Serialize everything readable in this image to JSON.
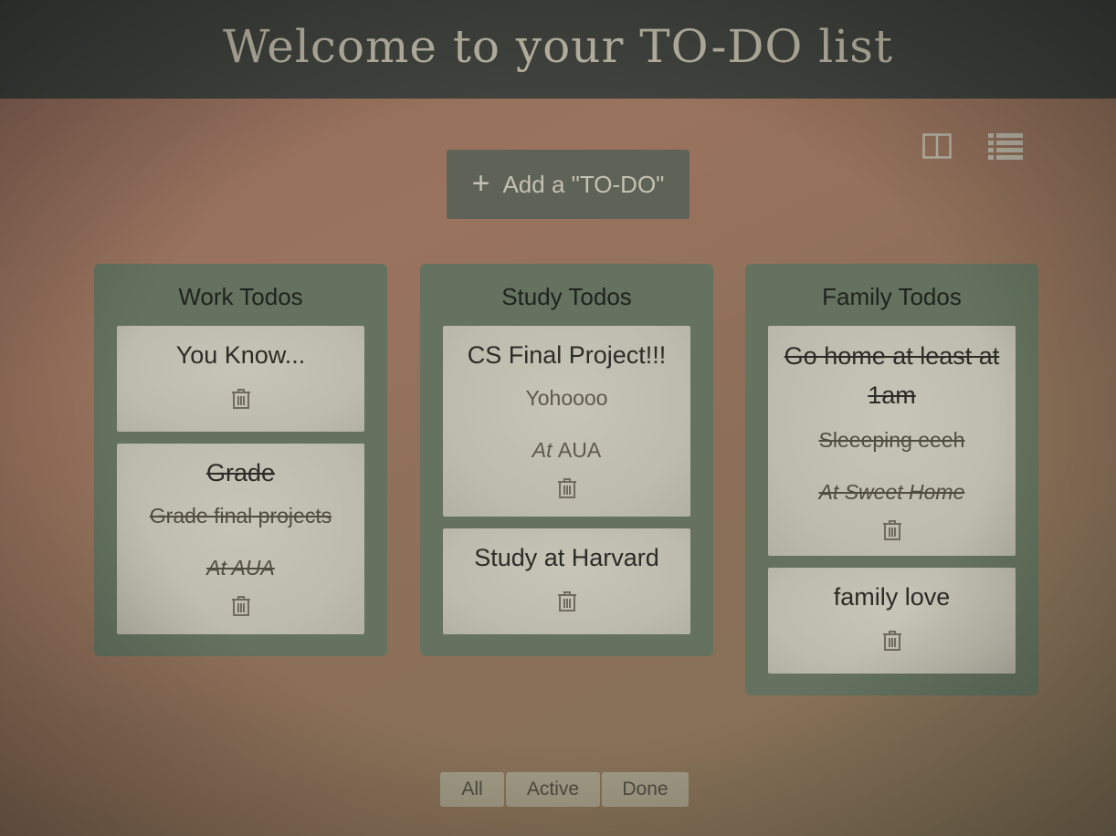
{
  "header": {
    "title": "Welcome to your TO-DO list"
  },
  "view_toggles": {
    "columns_icon": "columns-icon",
    "list_icon": "list-icon"
  },
  "add_button": {
    "icon": "plus-icon",
    "label": "Add a \"TO-DO\""
  },
  "columns": [
    {
      "title": "Work Todos",
      "cards": [
        {
          "title": "You Know...",
          "done": false
        },
        {
          "title": "Grade",
          "description": "Grade final projects",
          "at": "At",
          "location": "AUA",
          "done": true
        }
      ]
    },
    {
      "title": "Study Todos",
      "cards": [
        {
          "title": "CS Final Project!!!",
          "description": "Yohoooo",
          "at": "At",
          "location": "AUA",
          "done": false
        },
        {
          "title": "Study at Harvard",
          "done": false
        }
      ]
    },
    {
      "title": "Family Todos",
      "cards": [
        {
          "title": "Go home at least at 1am",
          "description": "Sleeeping eeeh",
          "at": "At",
          "location": "Sweet Home",
          "done": true
        },
        {
          "title": "family love",
          "done": false
        }
      ]
    }
  ],
  "filters": {
    "all": "All",
    "active": "Active",
    "done": "Done"
  },
  "colors": {
    "header_bg": "#3f423d",
    "column_bg": "#64725f",
    "card_bg": "#c3c1b3",
    "button_bg": "#5e6257"
  }
}
